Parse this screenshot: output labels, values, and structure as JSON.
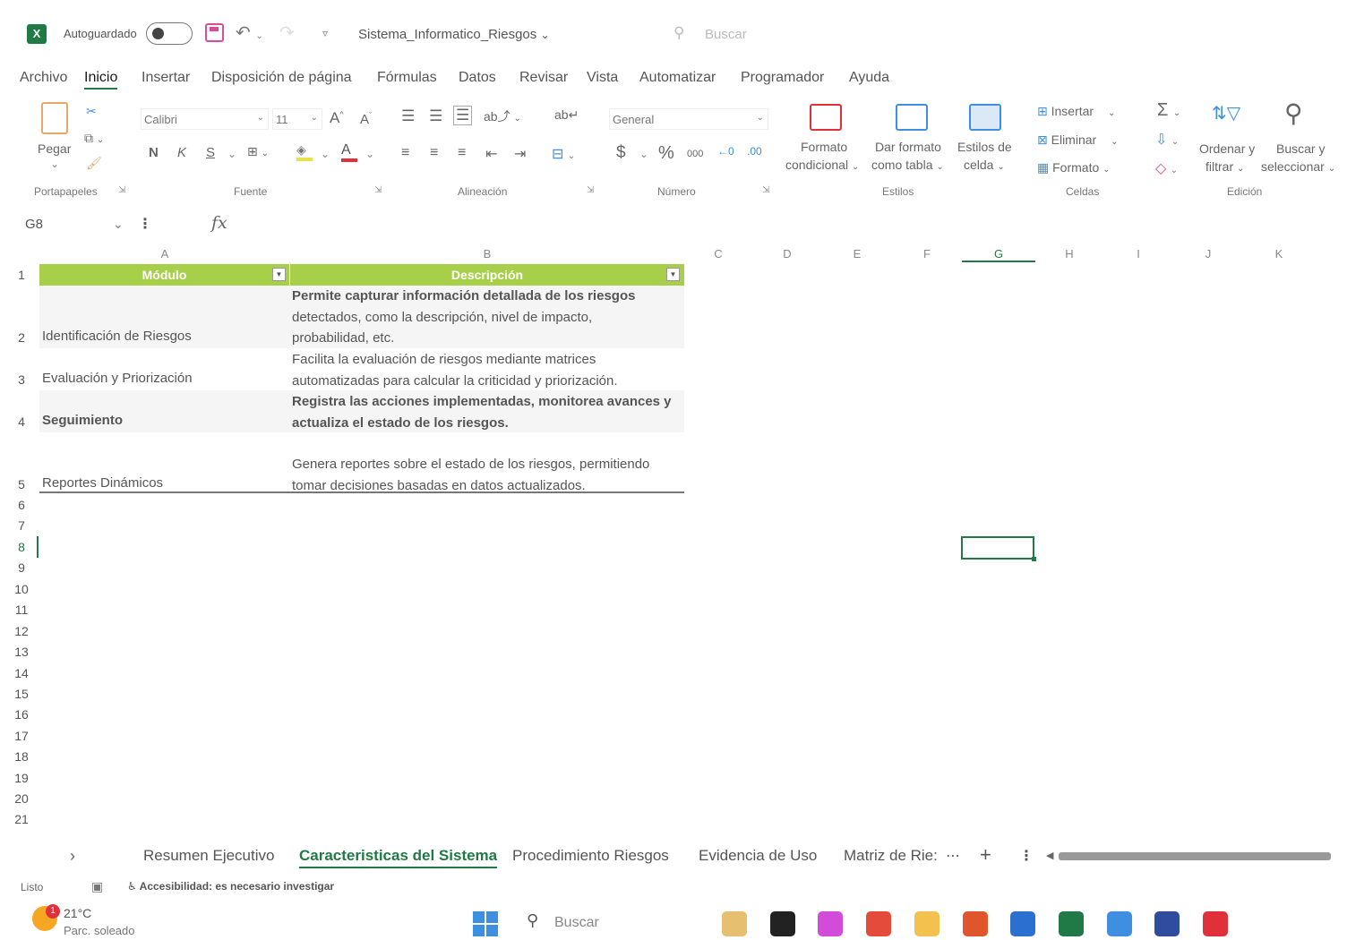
{
  "titlebar": {
    "app_icon": "excel-icon",
    "autosave_label": "Autoguardado",
    "autosave_on": false,
    "document_title": "Sistema_Informatico_Riesgos",
    "search_placeholder": "Buscar"
  },
  "ribbon_tabs": [
    "Archivo",
    "Inicio",
    "Insertar",
    "Disposición de página",
    "Fórmulas",
    "Datos",
    "Revisar",
    "Vista",
    "Automatizar",
    "Programador",
    "Ayuda"
  ],
  "active_tab": "Inicio",
  "ribbon": {
    "paste_label": "Pegar",
    "font_name": "Calibri",
    "font_size": "11",
    "bold": "N",
    "italic": "K",
    "underline": "S",
    "number_format": "General",
    "currency_symbol": "$",
    "percent_symbol": "%",
    "thousands": "000",
    "conditional_format": [
      "Formato",
      "condicional"
    ],
    "format_as_table": [
      "Dar formato",
      "como tabla"
    ],
    "cell_styles": [
      "Estilos de",
      "celda"
    ],
    "insert_label": "Insertar",
    "delete_label": "Eliminar",
    "format_label": "Formato",
    "sort_filter": [
      "Ordenar y",
      "filtrar"
    ],
    "find_select": [
      "Buscar y",
      "seleccionar"
    ],
    "groups": {
      "clipboard": "Portapapeles",
      "font": "Fuente",
      "alignment": "Alineación",
      "number": "Número",
      "styles": "Estilos",
      "cells": "Celdas",
      "editing": "Edición"
    }
  },
  "formula_bar": {
    "name_box": "G8",
    "fx_label": "fx",
    "content": ""
  },
  "grid": {
    "columns": [
      "A",
      "B",
      "C",
      "D",
      "E",
      "F",
      "G",
      "H",
      "I",
      "J",
      "K"
    ],
    "selected_column": "G",
    "row_numbers": [
      "1",
      "2",
      "3",
      "4",
      "5",
      "6",
      "7",
      "8",
      "9",
      "10",
      "11",
      "12",
      "13",
      "14",
      "15",
      "16",
      "17",
      "18",
      "19",
      "20",
      "21"
    ],
    "table_headers": [
      "Módulo",
      "Descripción"
    ],
    "rows": [
      {
        "module": "Identificación de Riesgos",
        "description_lines": [
          "Permite capturar información detallada de los riesgos",
          "detectados, como la descripción, nivel de impacto,",
          "probabilidad, etc."
        ]
      },
      {
        "module": "Evaluación y Priorización",
        "description_lines": [
          "Facilita la evaluación de riesgos mediante matrices",
          "automatizadas para calcular la criticidad y priorización."
        ]
      },
      {
        "module": "Seguimiento",
        "description_lines": [
          "Registra las acciones implementadas, monitorea avances y",
          "actualiza el estado de los riesgos."
        ]
      },
      {
        "module": "Reportes Dinámicos",
        "description_lines": [
          "Genera reportes sobre el estado de los riesgos, permitiendo",
          "tomar decisiones basadas en datos actualizados."
        ]
      }
    ]
  },
  "sheet_tabs": [
    "Resumen Ejecutivo",
    "Caracteristicas del Sistema",
    "Procedimiento Riesgos",
    "Evidencia de Uso",
    "Matriz de Rie:"
  ],
  "active_sheet": "Caracteristicas del Sistema",
  "statusbar": {
    "ready": "Listo",
    "accessibility": "Accesibilidad: es necesario investigar"
  },
  "taskbar": {
    "weather_temp": "21°C",
    "weather_desc": "Parc. soleado",
    "weather_badge": "1",
    "search_label": "Buscar",
    "apps": [
      "beach-landscape-icon",
      "black-app-icon",
      "copilot-icon",
      "chrome-icon",
      "file-explorer-icon",
      "brave-icon",
      "word-icon",
      "excel-icon",
      "photos-icon",
      "photoshop-icon",
      "acrobat-icon"
    ],
    "app_colors": [
      "#e6c070",
      "#222222",
      "#d24bd9",
      "#e44b3a",
      "#f2c14e",
      "#e0552c",
      "#2b6fd1",
      "#1f7a45",
      "#3f8fe0",
      "#2f4d9c",
      "#e0303a"
    ]
  }
}
